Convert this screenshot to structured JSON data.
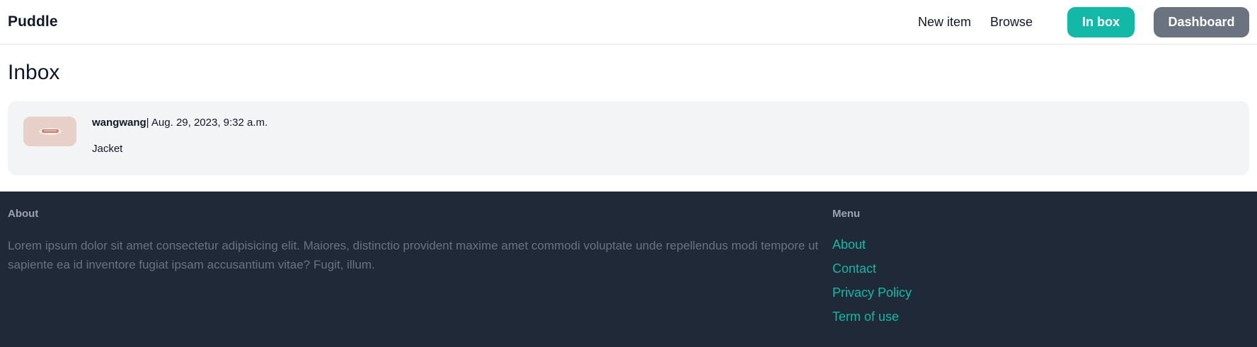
{
  "nav": {
    "logo": "Puddle",
    "links": [
      "New item",
      "Browse"
    ],
    "inbox_button": "In box",
    "dashboard_button": "Dashboard"
  },
  "main": {
    "title": "Inbox",
    "conversations": [
      {
        "username": "wangwang",
        "separator": "| ",
        "date": "Aug. 29, 2023, 9:32 a.m.",
        "item": "Jacket"
      }
    ]
  },
  "footer": {
    "about_title": "About",
    "about_text": "Lorem ipsum dolor sit amet consectetur adipisicing elit. Maiores, distinctio provident maxime amet commodi voluptate unde repellendus modi tempore ut sapiente ea id inventore fugiat ipsam accusantium vitae? Fugit, illum.",
    "menu_title": "Menu",
    "menu_links": [
      "About",
      "Contact",
      "Privacy Policy",
      "Term of use"
    ]
  },
  "colors": {
    "accent": "#14b8a6",
    "secondary_button": "#6b7280",
    "footer_bg": "#1f2937",
    "card_bg": "#f3f4f6"
  }
}
